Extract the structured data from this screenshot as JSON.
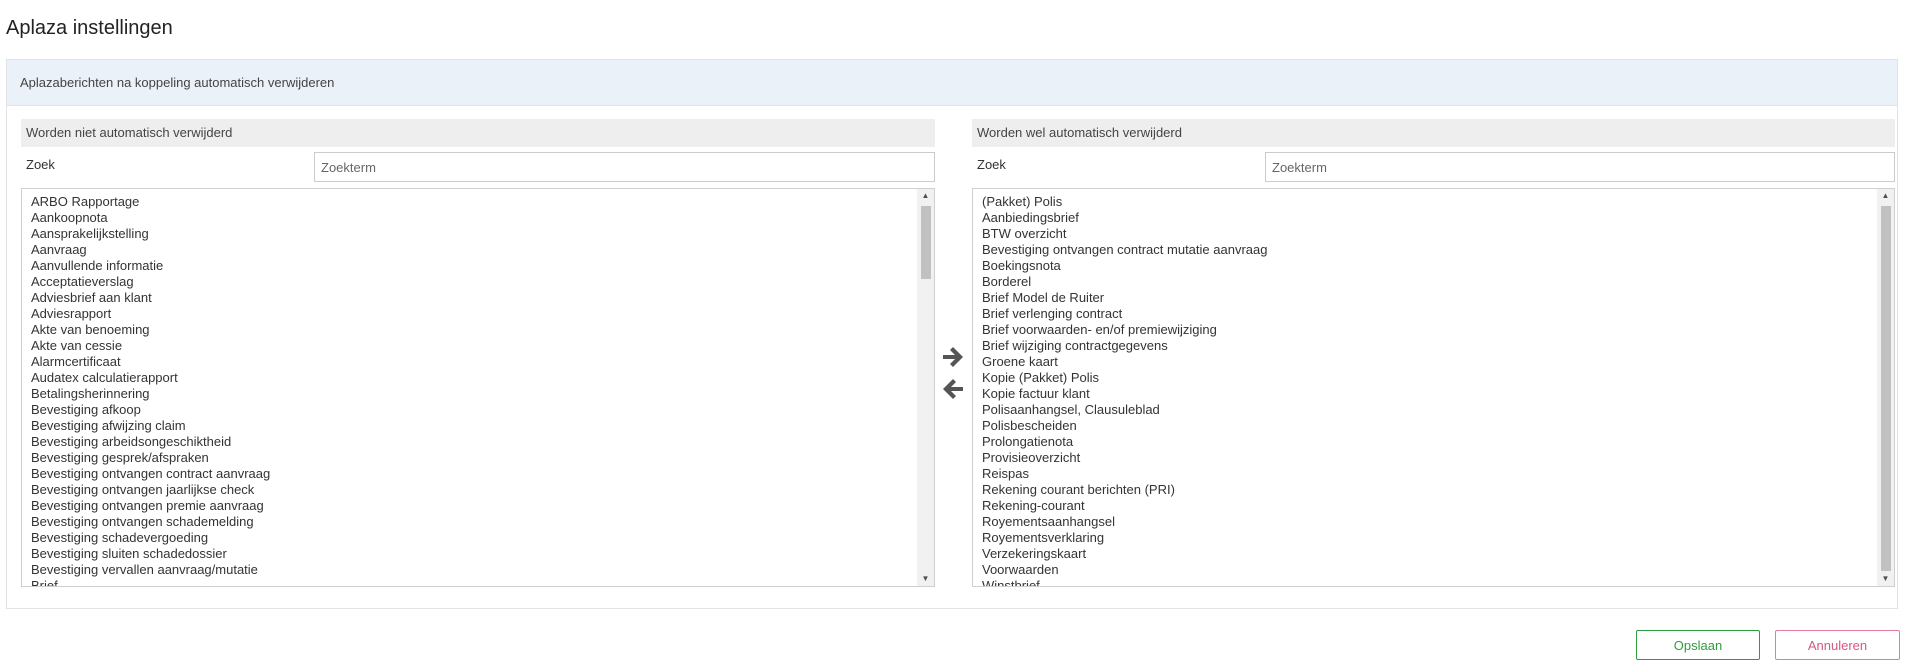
{
  "page_title": "Aplaza instellingen",
  "panel": {
    "header": "Aplazaberichten na koppeling automatisch verwijderen"
  },
  "left": {
    "header": "Worden niet automatisch verwijderd",
    "search_label": "Zoek",
    "search_placeholder": "Zoekterm",
    "items": [
      "ARBO Rapportage",
      "Aankoopnota",
      "Aansprakelijkstelling",
      "Aanvraag",
      "Aanvullende informatie",
      "Acceptatieverslag",
      "Adviesbrief aan klant",
      "Adviesrapport",
      "Akte van benoeming",
      "Akte van cessie",
      "Alarmcertificaat",
      "Audatex calculatierapport",
      "Betalingsherinnering",
      "Bevestiging afkoop",
      "Bevestiging afwijzing claim",
      "Bevestiging arbeidsongeschiktheid",
      "Bevestiging gesprek/afspraken",
      "Bevestiging ontvangen contract aanvraag",
      "Bevestiging ontvangen jaarlijkse check",
      "Bevestiging ontvangen premie aanvraag",
      "Bevestiging ontvangen schademelding",
      "Bevestiging schadevergoeding",
      "Bevestiging sluiten schadedossier",
      "Bevestiging vervallen aanvraag/mutatie",
      "Brief"
    ]
  },
  "right": {
    "header": "Worden wel automatisch verwijderd",
    "search_label": "Zoek",
    "search_placeholder": "Zoekterm",
    "items": [
      "(Pakket) Polis",
      "Aanbiedingsbrief",
      "BTW overzicht",
      "Bevestiging ontvangen contract mutatie aanvraag",
      "Boekingsnota",
      "Borderel",
      "Brief Model de Ruiter",
      "Brief verlenging contract",
      "Brief voorwaarden- en/of premiewijziging",
      "Brief wijziging contractgegevens",
      "Groene kaart",
      "Kopie (Pakket) Polis",
      "Kopie factuur klant",
      "Polisaanhangsel, Clausuleblad",
      "Polisbescheiden",
      "Prolongatienota",
      "Provisieoverzicht",
      "Reispas",
      "Rekening courant berichten (PRI)",
      "Rekening-courant",
      "Royementsaanhangsel",
      "Royementsverklaring",
      "Verzekeringskaart",
      "Voorwaarden",
      "Winstbrief"
    ]
  },
  "scroll_up_glyph": "▲",
  "scroll_down_glyph": "▼",
  "buttons": {
    "save": "Opslaan",
    "cancel": "Annuleren"
  },
  "icons": {
    "move_right": "arrow-right-icon",
    "move_left": "arrow-left-icon"
  },
  "colors": {
    "save": "#2e9b3d",
    "cancel": "#d9577f",
    "panel_header_bg": "#eaf1f8"
  }
}
